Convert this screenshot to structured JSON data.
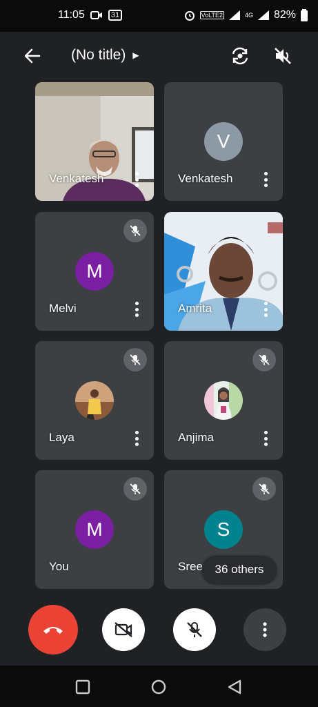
{
  "status_bar": {
    "time": "11:05",
    "calendar_badge": "31",
    "network_badge": "VoLTE2",
    "lte_label": "4G",
    "battery": "82%"
  },
  "header": {
    "title": "(No title)"
  },
  "tiles": [
    {
      "name": "Venkatesh",
      "type": "video",
      "muted": false
    },
    {
      "name": "Venkatesh",
      "type": "avatar",
      "initial": "V",
      "avatar_color": "#8d99a4",
      "muted": false
    },
    {
      "name": "Melvi",
      "type": "avatar",
      "initial": "M",
      "avatar_color": "#7b1fa2",
      "muted": true
    },
    {
      "name": "Amrita",
      "type": "video",
      "muted": false
    },
    {
      "name": "Laya",
      "type": "photo",
      "muted": true
    },
    {
      "name": "Anjima",
      "type": "photo",
      "muted": true
    },
    {
      "name": "You",
      "type": "avatar",
      "initial": "M",
      "avatar_color": "#7b1fa2",
      "muted": true
    },
    {
      "name": "Sree",
      "type": "avatar",
      "initial": "S",
      "avatar_color": "#00838f",
      "muted": true
    }
  ],
  "others_count_label": "36 others",
  "colors": {
    "background": "#202124",
    "tile": "#3c4043",
    "end_call": "#ea4335",
    "muted_badge": "#5f6368"
  }
}
